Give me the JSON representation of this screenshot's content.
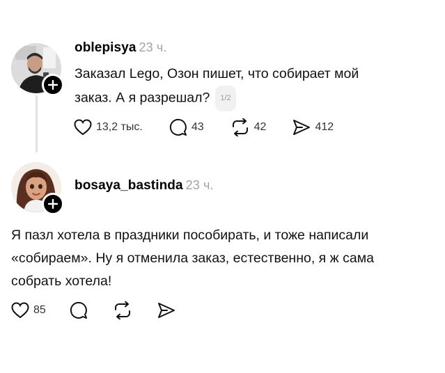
{
  "posts": [
    {
      "author": "oblepisya",
      "time": "23 ч.",
      "text_lines": [
        "Заказал Lego, Озон пишет, что собирает мой",
        "заказ. А я разрешал?"
      ],
      "page_indicator": "1/2",
      "likes": "13,2 тыс.",
      "comments": "43",
      "reposts": "42",
      "shares": "412"
    },
    {
      "author": "bosaya_bastinda",
      "time": "23 ч.",
      "text_lines": [
        "Я пазл хотела в праздники пособирать, и тоже написали",
        "«собираем». Ну я отменила заказ, естественно, я ж сама",
        "собрать хотела!"
      ],
      "likes": "85"
    }
  ],
  "icons": [
    "heart-icon",
    "comment-icon",
    "repost-icon",
    "share-icon",
    "plus-icon"
  ],
  "colors": {
    "time": "#a3a3a3",
    "thread_line": "#e2e2e2",
    "follow_badge": "#000000"
  }
}
